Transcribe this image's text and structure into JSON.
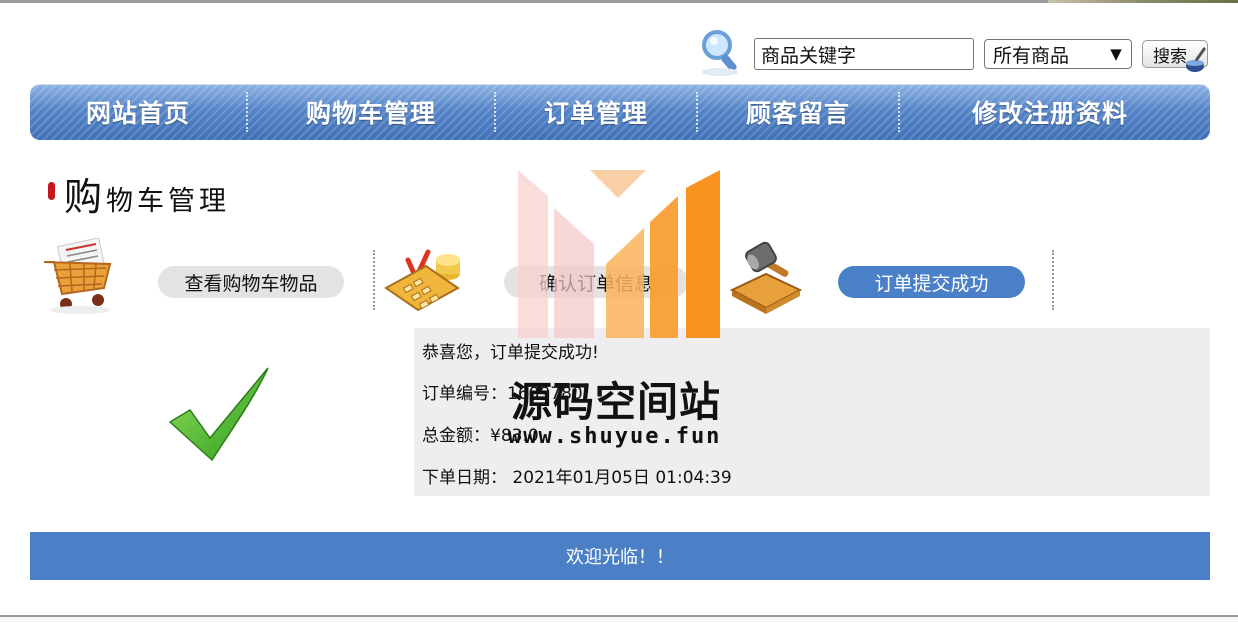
{
  "search": {
    "input_value": "商品关键字",
    "category_selected": "所有商品",
    "button_label": "搜索"
  },
  "nav": {
    "items": [
      {
        "label": "网站首页"
      },
      {
        "label": "购物车管理"
      },
      {
        "label": "订单管理"
      },
      {
        "label": "顾客留言"
      },
      {
        "label": "修改注册资料"
      }
    ]
  },
  "section": {
    "title_first": "购",
    "title_rest": "物车管理"
  },
  "steps": [
    {
      "label": "查看购物车物品",
      "icon": "shopping-cart-icon",
      "active": false
    },
    {
      "label": "确认订单信息",
      "icon": "calculator-icon",
      "active": false
    },
    {
      "label": "订单提交成功",
      "icon": "gavel-icon",
      "active": true
    }
  ],
  "result": {
    "message": "恭喜您，订单提交成功!",
    "order_no_label": "订单编号：",
    "order_no_value": "1609780",
    "total_label": "总金额：",
    "total_value": "¥83.0",
    "date_label": "下单日期：",
    "date_value": "2021年01月05日 01:04:39"
  },
  "footer": {
    "text": "欢迎光临！！"
  },
  "watermark": {
    "title": "源码空间站",
    "url": "www.shuyue.fun"
  },
  "colors": {
    "nav_blue": "#4f80c5",
    "footer_blue": "#4b80c6",
    "active_pill": "#4a80c8",
    "info_bg": "#eeedf0",
    "watermark_orange": "#f7931e"
  }
}
